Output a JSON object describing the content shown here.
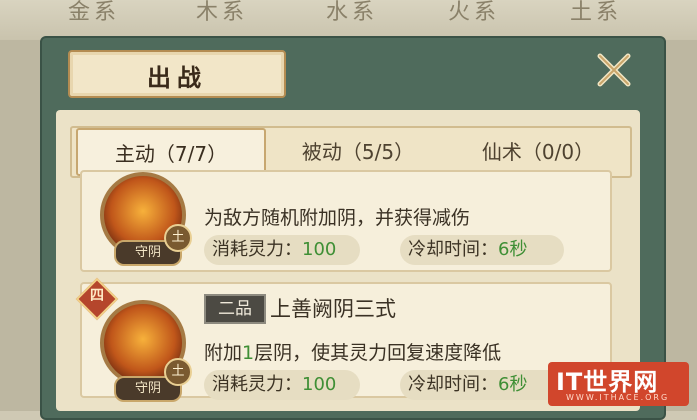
{
  "elements_tabs": [
    "金系",
    "木系",
    "水系",
    "火系",
    "土系"
  ],
  "title": "出战",
  "tabs": [
    {
      "label": "主动（7/7）",
      "active": true
    },
    {
      "label": "被动（5/5）",
      "active": false
    },
    {
      "label": "仙术（0/0）",
      "active": false
    }
  ],
  "skills": [
    {
      "description": "为敌方随机附加阴，并获得减伤",
      "cost_label": "消耗灵力：",
      "cost_value": "100",
      "cooldown_label": "冷却时间：",
      "cooldown_value": "6秒",
      "icon_tag": "守阴",
      "element_badge": "土"
    },
    {
      "number": "四",
      "grade": "二品",
      "name": "上善阙阴三式",
      "description_pre": "附加",
      "description_highlight": "1",
      "description_post": "层阴，使其灵力回复速度降低",
      "cost_label": "消耗灵力：",
      "cost_value": "100",
      "cooldown_label": "冷却时间：",
      "cooldown_value": "6秒",
      "icon_tag": "守阴",
      "element_badge": "土"
    }
  ],
  "watermark": {
    "main": "IT世界网",
    "sub": "WWW.ITHACE.ORG"
  },
  "colors": {
    "panel": "#4f6b5c",
    "value_green": "#3f8f35",
    "badge_red": "#b5462c"
  }
}
